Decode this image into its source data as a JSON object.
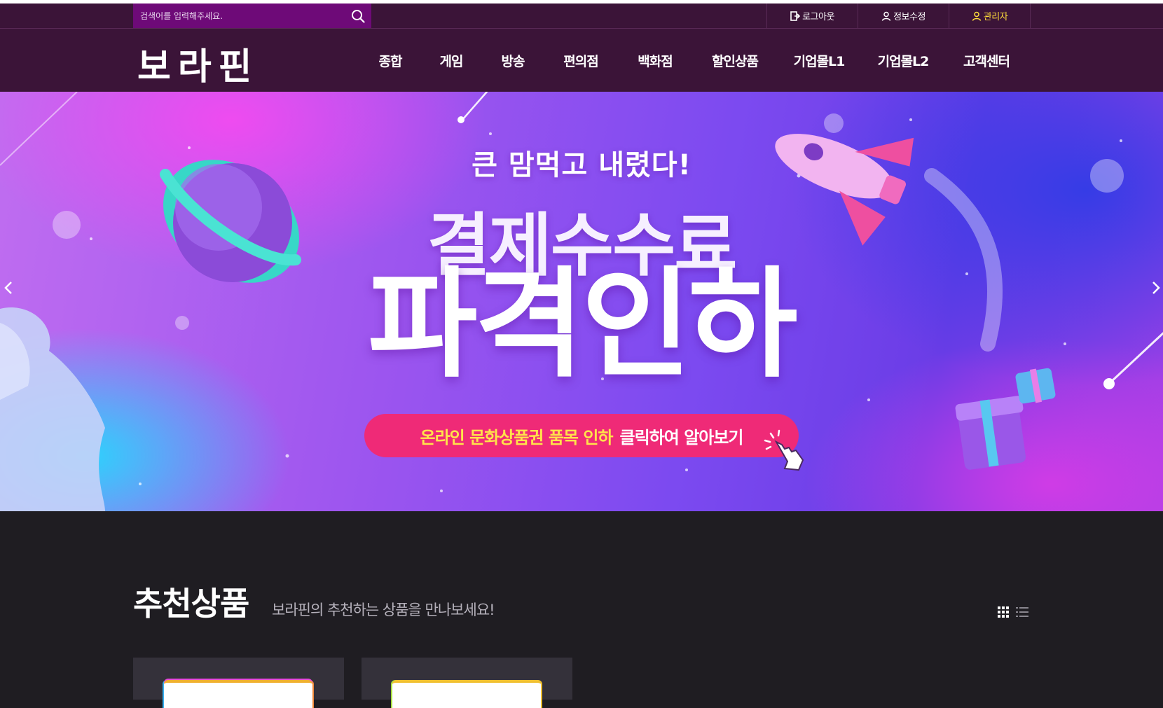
{
  "search": {
    "placeholder": "검색어를 입력해주세요."
  },
  "util": {
    "logout": "로그아웃",
    "edit_info": "정보수정",
    "admin": "관리자"
  },
  "logo": "보라핀",
  "nav": [
    "종합",
    "게임",
    "방송",
    "편의점",
    "백화점",
    "할인상품",
    "기업몰L1",
    "기업몰L2",
    "고객센터"
  ],
  "banner": {
    "subtitle": "큰 맘먹고 내렸다!",
    "title_line1": "결제수수료",
    "title_line2": "파격인하",
    "cta_highlight": "온라인 문화상품권 품목 인하",
    "cta_text": "클릭하여 알아보기"
  },
  "recommend": {
    "title": "추천상품",
    "subtitle": "보라핀의 추천하는 상품을 만나보세요!"
  },
  "colors": {
    "header_bg": "#3b1438",
    "search_bg": "#6e0a78",
    "admin_accent": "#ffde3a",
    "cta_bg": "#ef2a77",
    "cta_highlight": "#ffe34a",
    "section_bg": "#1f1d22"
  },
  "icons": [
    "search-icon",
    "logout-icon",
    "user-icon",
    "admin-user-icon",
    "grid-view-icon",
    "list-view-icon",
    "hand-pointer-icon"
  ]
}
